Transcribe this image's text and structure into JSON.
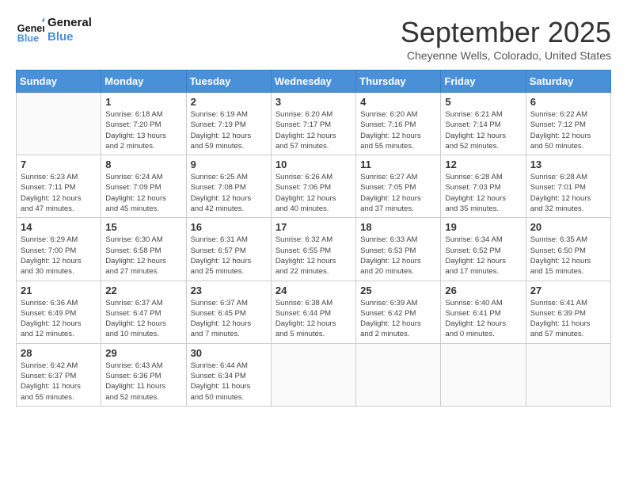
{
  "header": {
    "logo": {
      "line1": "General",
      "line2": "Blue"
    },
    "title": "September 2025",
    "location": "Cheyenne Wells, Colorado, United States"
  },
  "weekdays": [
    "Sunday",
    "Monday",
    "Tuesday",
    "Wednesday",
    "Thursday",
    "Friday",
    "Saturday"
  ],
  "weeks": [
    [
      {
        "day": "",
        "info": ""
      },
      {
        "day": "1",
        "info": "Sunrise: 6:18 AM\nSunset: 7:20 PM\nDaylight: 13 hours\nand 2 minutes."
      },
      {
        "day": "2",
        "info": "Sunrise: 6:19 AM\nSunset: 7:19 PM\nDaylight: 12 hours\nand 59 minutes."
      },
      {
        "day": "3",
        "info": "Sunrise: 6:20 AM\nSunset: 7:17 PM\nDaylight: 12 hours\nand 57 minutes."
      },
      {
        "day": "4",
        "info": "Sunrise: 6:20 AM\nSunset: 7:16 PM\nDaylight: 12 hours\nand 55 minutes."
      },
      {
        "day": "5",
        "info": "Sunrise: 6:21 AM\nSunset: 7:14 PM\nDaylight: 12 hours\nand 52 minutes."
      },
      {
        "day": "6",
        "info": "Sunrise: 6:22 AM\nSunset: 7:12 PM\nDaylight: 12 hours\nand 50 minutes."
      }
    ],
    [
      {
        "day": "7",
        "info": "Sunrise: 6:23 AM\nSunset: 7:11 PM\nDaylight: 12 hours\nand 47 minutes."
      },
      {
        "day": "8",
        "info": "Sunrise: 6:24 AM\nSunset: 7:09 PM\nDaylight: 12 hours\nand 45 minutes."
      },
      {
        "day": "9",
        "info": "Sunrise: 6:25 AM\nSunset: 7:08 PM\nDaylight: 12 hours\nand 42 minutes."
      },
      {
        "day": "10",
        "info": "Sunrise: 6:26 AM\nSunset: 7:06 PM\nDaylight: 12 hours\nand 40 minutes."
      },
      {
        "day": "11",
        "info": "Sunrise: 6:27 AM\nSunset: 7:05 PM\nDaylight: 12 hours\nand 37 minutes."
      },
      {
        "day": "12",
        "info": "Sunrise: 6:28 AM\nSunset: 7:03 PM\nDaylight: 12 hours\nand 35 minutes."
      },
      {
        "day": "13",
        "info": "Sunrise: 6:28 AM\nSunset: 7:01 PM\nDaylight: 12 hours\nand 32 minutes."
      }
    ],
    [
      {
        "day": "14",
        "info": "Sunrise: 6:29 AM\nSunset: 7:00 PM\nDaylight: 12 hours\nand 30 minutes."
      },
      {
        "day": "15",
        "info": "Sunrise: 6:30 AM\nSunset: 6:58 PM\nDaylight: 12 hours\nand 27 minutes."
      },
      {
        "day": "16",
        "info": "Sunrise: 6:31 AM\nSunset: 6:57 PM\nDaylight: 12 hours\nand 25 minutes."
      },
      {
        "day": "17",
        "info": "Sunrise: 6:32 AM\nSunset: 6:55 PM\nDaylight: 12 hours\nand 22 minutes."
      },
      {
        "day": "18",
        "info": "Sunrise: 6:33 AM\nSunset: 6:53 PM\nDaylight: 12 hours\nand 20 minutes."
      },
      {
        "day": "19",
        "info": "Sunrise: 6:34 AM\nSunset: 6:52 PM\nDaylight: 12 hours\nand 17 minutes."
      },
      {
        "day": "20",
        "info": "Sunrise: 6:35 AM\nSunset: 6:50 PM\nDaylight: 12 hours\nand 15 minutes."
      }
    ],
    [
      {
        "day": "21",
        "info": "Sunrise: 6:36 AM\nSunset: 6:49 PM\nDaylight: 12 hours\nand 12 minutes."
      },
      {
        "day": "22",
        "info": "Sunrise: 6:37 AM\nSunset: 6:47 PM\nDaylight: 12 hours\nand 10 minutes."
      },
      {
        "day": "23",
        "info": "Sunrise: 6:37 AM\nSunset: 6:45 PM\nDaylight: 12 hours\nand 7 minutes."
      },
      {
        "day": "24",
        "info": "Sunrise: 6:38 AM\nSunset: 6:44 PM\nDaylight: 12 hours\nand 5 minutes."
      },
      {
        "day": "25",
        "info": "Sunrise: 6:39 AM\nSunset: 6:42 PM\nDaylight: 12 hours\nand 2 minutes."
      },
      {
        "day": "26",
        "info": "Sunrise: 6:40 AM\nSunset: 6:41 PM\nDaylight: 12 hours\nand 0 minutes."
      },
      {
        "day": "27",
        "info": "Sunrise: 6:41 AM\nSunset: 6:39 PM\nDaylight: 11 hours\nand 57 minutes."
      }
    ],
    [
      {
        "day": "28",
        "info": "Sunrise: 6:42 AM\nSunset: 6:37 PM\nDaylight: 11 hours\nand 55 minutes."
      },
      {
        "day": "29",
        "info": "Sunrise: 6:43 AM\nSunset: 6:36 PM\nDaylight: 11 hours\nand 52 minutes."
      },
      {
        "day": "30",
        "info": "Sunrise: 6:44 AM\nSunset: 6:34 PM\nDaylight: 11 hours\nand 50 minutes."
      },
      {
        "day": "",
        "info": ""
      },
      {
        "day": "",
        "info": ""
      },
      {
        "day": "",
        "info": ""
      },
      {
        "day": "",
        "info": ""
      }
    ]
  ]
}
